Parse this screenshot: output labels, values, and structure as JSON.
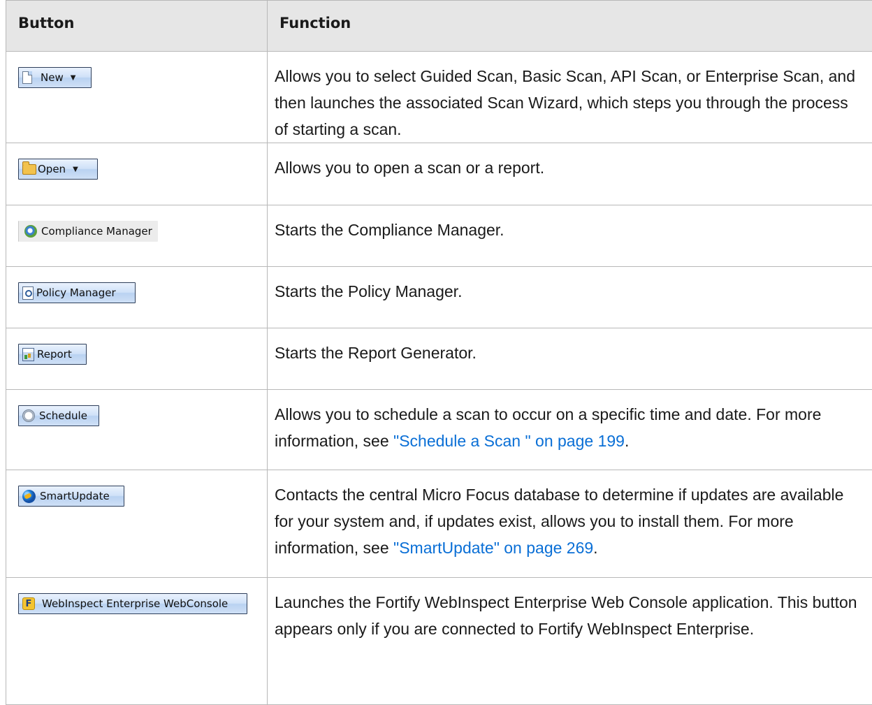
{
  "header": {
    "col_button": "Button",
    "col_function": "Function"
  },
  "rows": [
    {
      "button": {
        "label": "New",
        "icon": "new-document-icon",
        "dropdown": true
      },
      "function": "Allows you to select Guided Scan, Basic Scan, API Scan, or Enterprise Scan, and then launches the associated Scan Wizard, which steps you through the process of starting a scan."
    },
    {
      "button": {
        "label": "Open",
        "icon": "open-folder-icon",
        "dropdown": true
      },
      "function": "Allows you to open a scan or a report."
    },
    {
      "button": {
        "label": "Compliance Manager",
        "icon": "compliance-magnifier-icon"
      },
      "function": "Starts the Compliance Manager."
    },
    {
      "button": {
        "label": "Policy Manager",
        "icon": "policy-document-icon"
      },
      "function": "Starts the Policy Manager."
    },
    {
      "button": {
        "label": "Report",
        "icon": "report-icon"
      },
      "function": "Starts the Report Generator."
    },
    {
      "button": {
        "label": "Schedule",
        "icon": "clock-icon"
      },
      "function_before": "Allows you to schedule a scan to occur on a specific time and date. For more information, see ",
      "link": "\"Schedule a Scan \" on page 199",
      "function_after": "."
    },
    {
      "button": {
        "label": "SmartUpdate",
        "icon": "globe-icon"
      },
      "function_before": "Contacts the central Micro Focus database to determine if updates are available for your system and, if updates exist, allows you to install them. For more information, see ",
      "link": "\"SmartUpdate\" on page 269",
      "function_after": "."
    },
    {
      "button": {
        "label": "WebInspect Enterprise WebConsole",
        "icon": "fortify-logo-icon",
        "icon_letter": "F"
      },
      "function": "Launches the Fortify WebInspect Enterprise Web Console application. This button appears only if you are connected to Fortify WebInspect Enterprise."
    }
  ]
}
